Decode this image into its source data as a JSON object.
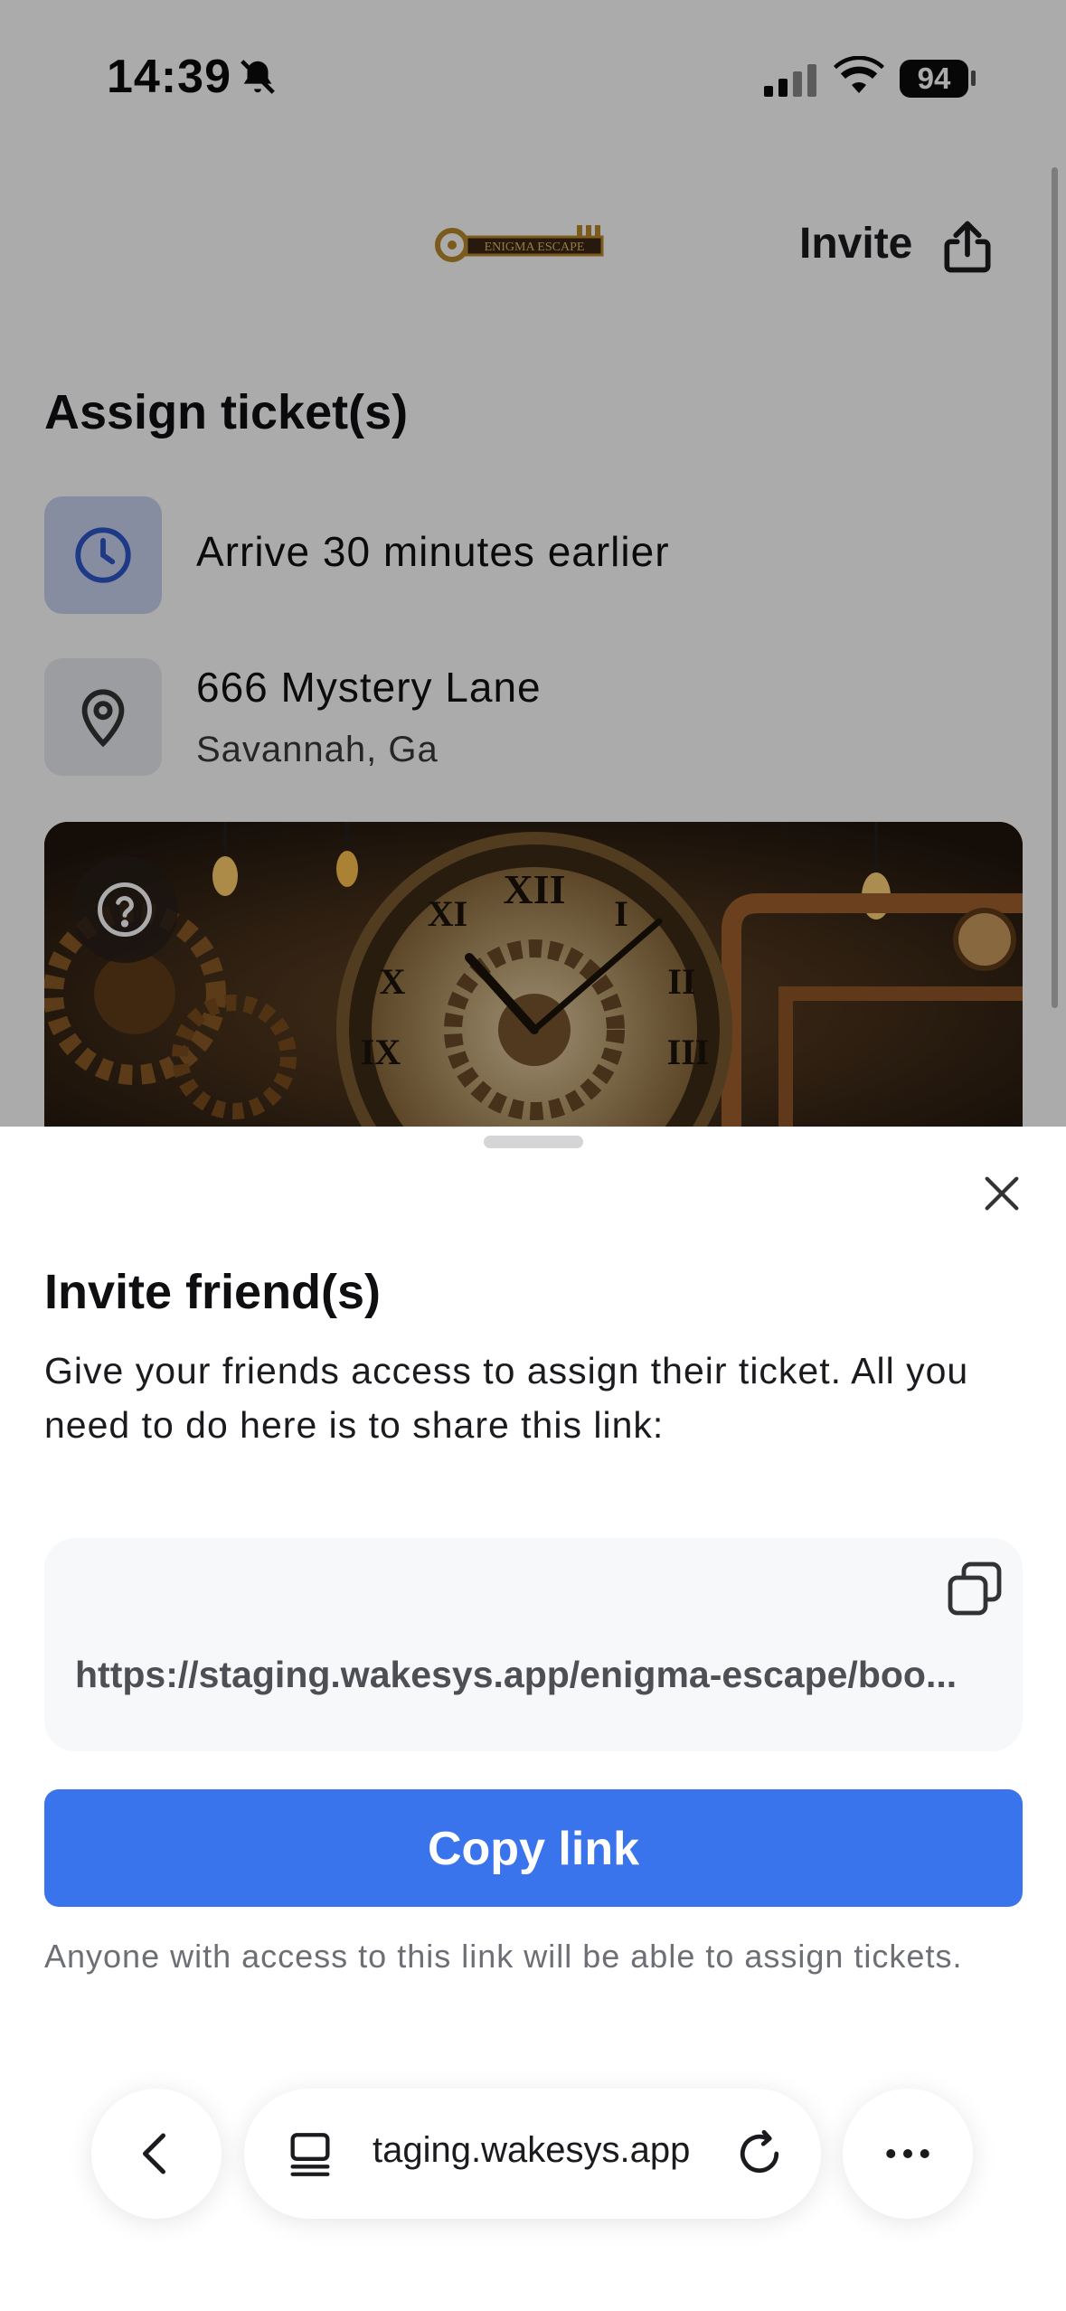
{
  "status_bar": {
    "time": "14:39",
    "battery": "94",
    "icons": [
      "bell-slash-icon",
      "cellular-signal-icon",
      "wifi-icon",
      "battery-icon"
    ]
  },
  "header": {
    "logo_text": "ENIGMA ESCAPE",
    "invite_label": "Invite"
  },
  "page": {
    "title": "Assign ticket(s)",
    "arrival": "Arrive 30 minutes earlier",
    "address_line1": "666 Mystery Lane",
    "address_line2": "Savannah, Ga"
  },
  "sheet": {
    "title": "Invite friend(s)",
    "description": "Give your friends access to assign their ticket. All you need to do here is to share this link:",
    "link": "https://staging.wakesys.app/enigma-escape/boo...",
    "copy_button": "Copy link",
    "footnote": "Anyone with access to this link will be able to assign tickets."
  },
  "browser": {
    "url": "taging.wakesys.app"
  },
  "colors": {
    "accent": "#3a74ec",
    "clock_tile": "#c8d3ef",
    "scrim": "rgba(0,0,0,0.33)"
  }
}
